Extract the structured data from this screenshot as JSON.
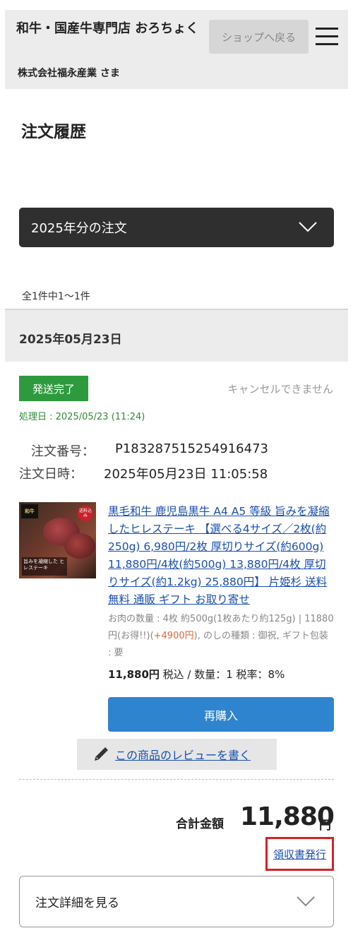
{
  "header": {
    "shop_name": "和牛・国産牛専門店 おろちょく",
    "customer": "株式会社福永産業 さま",
    "back_button": "ショップへ戻る",
    "menu_icon": "hamburger-icon"
  },
  "page": {
    "title": "注文履歴"
  },
  "filter": {
    "year_label": "2025年分の注文",
    "icon": "chevron-down-icon"
  },
  "list": {
    "count_text": "全1件中1〜1件"
  },
  "order": {
    "date_heading": "2025年05月23日",
    "status": "発送完了",
    "cancel_note": "キャンセルできません",
    "processed": "処理日 : 2025/05/23 (11:24)",
    "order_number_label": "注文番号：",
    "order_number": "P183287515254916473",
    "order_datetime_label": "注文日時：",
    "order_datetime": "2025年05月23日 11:05:58",
    "product": {
      "title": "黒毛和牛 鹿児島黒牛 A4 A5 等級 旨みを凝縮したヒレステーキ 【選べる4サイズ／2枚(約250g) 6,980円/2枚 厚切りサイズ(約600g) 11,880円/4枚(約500g) 13,880円/4枚 厚切りサイズ(約1.2kg) 25,880円】 片姫杉 送料無料 通販 ギフト お取り寄せ",
      "options_pre": "お肉の数量 : 4枚 約500g(1枚あたり約125g) | 11880円(お得!!)(",
      "options_bonus": "+4900円",
      "options_post": "), のしの種類 : 御祝, ギフト包装 : 要",
      "price": "11,880円",
      "price_suffix": " 税込 / 数量：1 税率：8%",
      "image_tag": "和牛",
      "image_badge": "送料込み",
      "image_caption": "旨みを凝縮した ヒレステーキ"
    },
    "rebuy_button": "再購入",
    "review_button": "この商品のレビューを書く",
    "review_icon": "pencil-icon",
    "total_label": "合計金額",
    "total_value": "11,880",
    "total_unit": "円",
    "receipt_link": "領収書発行",
    "detail_toggle": "注文詳細を見る",
    "detail_icon": "chevron-down-icon"
  },
  "colors": {
    "status_green": "#2e9a3e",
    "rebuy_blue": "#2f84cf",
    "link_blue": "#1a4fb0",
    "highlight_red": "#d62222"
  }
}
